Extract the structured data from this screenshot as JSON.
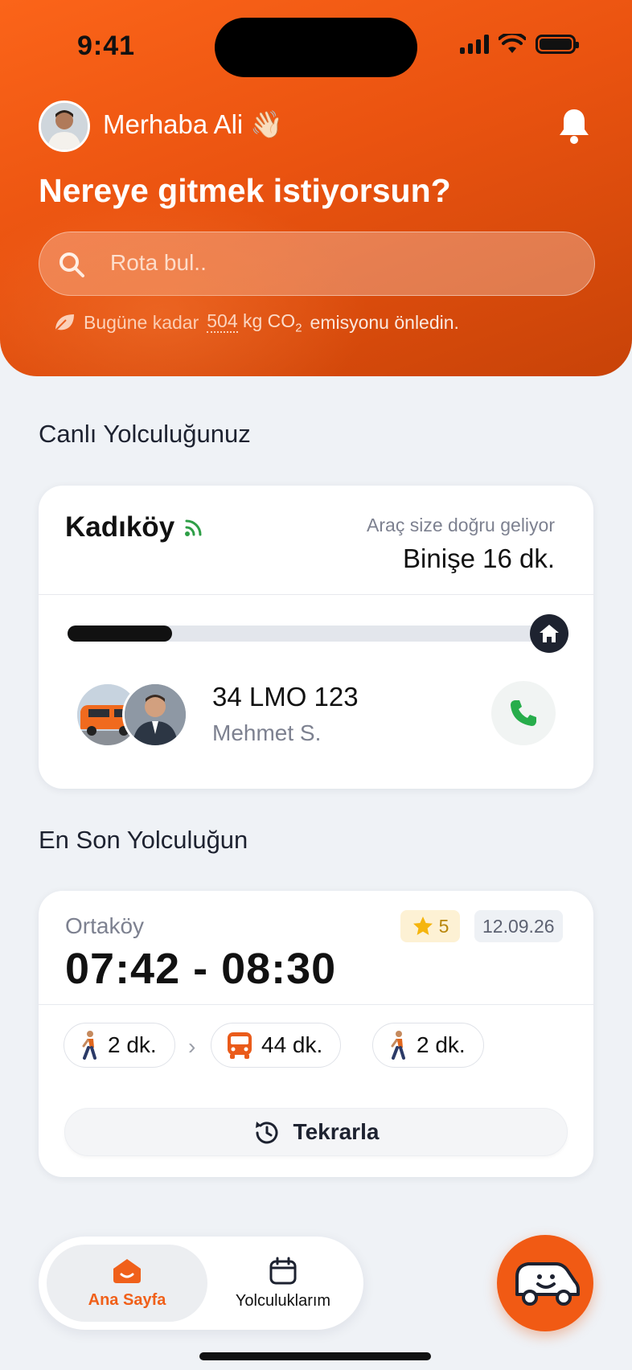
{
  "status_bar": {
    "time": "9:41"
  },
  "header": {
    "greeting": "Merhaba Ali 👋🏻",
    "headline": "Nereye gitmek istiyorsun?",
    "search_placeholder": "Rota bul..",
    "co2": {
      "prefix": "Bugüne kadar",
      "amount": "504",
      "unit": "kg CO",
      "subscript": "2",
      "suffix": "emisyonu önledin."
    }
  },
  "live_trip": {
    "section_title": "Canlı Yolculuğunuz",
    "destination": "Kadıköy",
    "status": "Araç size doğru geliyor",
    "eta": "Binişe 16 dk.",
    "progress": 0.22,
    "plate": "34 LMO 123",
    "driver": "Mehmet S."
  },
  "last_trip": {
    "section_title": "En Son Yolculuğun",
    "origin": "Ortaköy",
    "time_range": "07:42 - 08:30",
    "rating": "5",
    "date": "12.09.26",
    "legs": [
      {
        "icon": "walk-icon",
        "label": "2 dk."
      },
      {
        "icon": "bus-icon",
        "label": "44 dk."
      },
      {
        "icon": "walk-icon",
        "label": "2 dk."
      }
    ],
    "repeat_label": "Tekrarla"
  },
  "tabbar": {
    "home_label": "Ana Sayfa",
    "trips_label": "Yolculuklarım"
  },
  "colors": {
    "accent": "#f15a14",
    "live_signal": "#2e9e46",
    "call": "#27ad4b"
  }
}
